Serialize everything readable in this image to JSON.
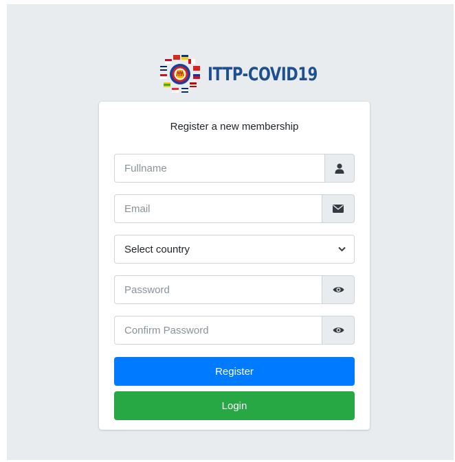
{
  "brand": {
    "name": "ITTP-COVID19",
    "color": "#1e4f8e"
  },
  "form": {
    "title": "Register a new membership",
    "fullname": {
      "placeholder": "Fullname",
      "icon": "user-icon"
    },
    "email": {
      "placeholder": "Email",
      "icon": "envelope-icon"
    },
    "country": {
      "selected": "Select country",
      "icon": "chevron-down-icon"
    },
    "password": {
      "placeholder": "Password",
      "icon": "eye-icon"
    },
    "confirm_password": {
      "placeholder": "Confirm Password",
      "icon": "eye-icon"
    }
  },
  "buttons": {
    "register": {
      "label": "Register",
      "color": "#007bff"
    },
    "login": {
      "label": "Login",
      "color": "#28a745"
    }
  }
}
